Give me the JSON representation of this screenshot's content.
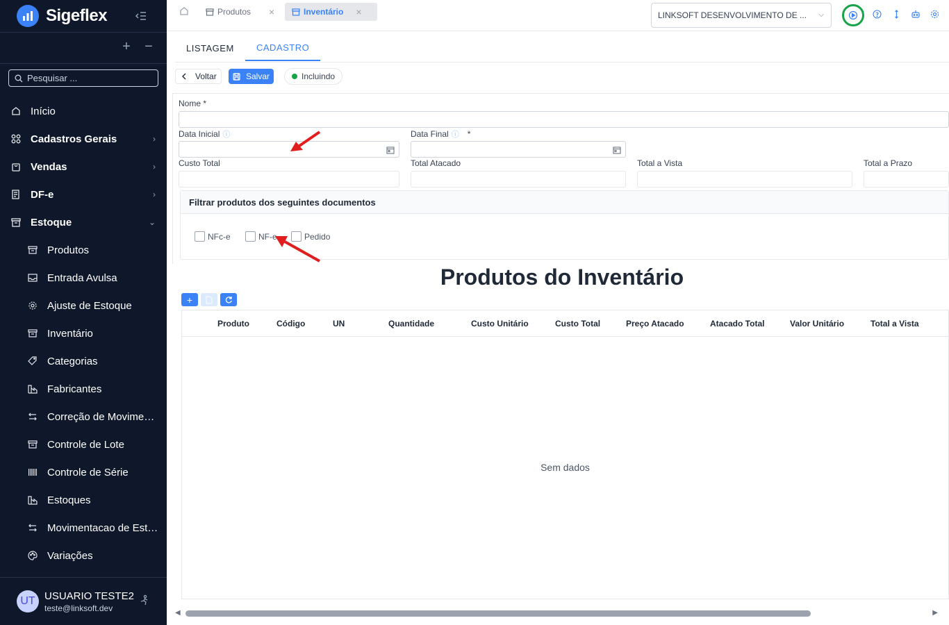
{
  "app": {
    "name": "Sigeflex"
  },
  "sidebar": {
    "search_placeholder": "Pesquisar ...",
    "items": [
      {
        "label": "Início",
        "icon": "home-icon"
      },
      {
        "label": "Cadastros Gerais",
        "icon": "grid-icon"
      },
      {
        "label": "Vendas",
        "icon": "shopping-bag-icon"
      },
      {
        "label": "DF-e",
        "icon": "document-icon"
      },
      {
        "label": "Estoque",
        "icon": "archive-icon"
      }
    ],
    "subitems": [
      {
        "label": "Produtos",
        "icon": "box-icon"
      },
      {
        "label": "Entrada Avulsa",
        "icon": "inbox-icon"
      },
      {
        "label": "Ajuste de Estoque",
        "icon": "settings-icon"
      },
      {
        "label": "Inventário",
        "icon": "box-icon"
      },
      {
        "label": "Categorias",
        "icon": "tag-icon"
      },
      {
        "label": "Fabricantes",
        "icon": "factory-icon"
      },
      {
        "label": "Correção de Movimento",
        "icon": "swap-icon"
      },
      {
        "label": "Controle de Lote",
        "icon": "box-icon"
      },
      {
        "label": "Controle de Série",
        "icon": "barcode-icon"
      },
      {
        "label": "Estoques",
        "icon": "factory-icon"
      },
      {
        "label": "Movimentacao de Estoque",
        "icon": "swap-icon"
      },
      {
        "label": "Variações",
        "icon": "palette-icon"
      }
    ],
    "user": {
      "initials": "UT",
      "name": "USUARIO TESTE2",
      "email": "teste@linksoft.dev"
    }
  },
  "topbar": {
    "tabs": [
      {
        "label": "Produtos",
        "active": false
      },
      {
        "label": "Inventário",
        "active": true
      }
    ],
    "close_glyph": "×",
    "company": "LINKSOFT DESENVOLVIMENTO DE ..."
  },
  "inner_tabs": [
    {
      "label": "LISTAGEM",
      "active": false
    },
    {
      "label": "CADASTRO",
      "active": true
    }
  ],
  "actions": {
    "back": "Voltar",
    "save": "Salvar",
    "status": "Incluindo"
  },
  "form": {
    "nome_label": "Nome *",
    "data_inicial_label": "Data Inicial",
    "data_final_label": "Data Final",
    "required_mark": "*",
    "custo_total_label": "Custo Total",
    "total_atacado_label": "Total Atacado",
    "total_vista_label": "Total a Vista",
    "total_prazo_label": "Total a Prazo"
  },
  "filter": {
    "title": "Filtrar produtos dos seguintes documentos",
    "options": [
      {
        "label": "NFc-e",
        "checked": false
      },
      {
        "label": "NF-e",
        "checked": false
      },
      {
        "label": "Pedido",
        "checked": false
      }
    ]
  },
  "products": {
    "title": "Produtos do Inventário",
    "columns": [
      "Produto",
      "Código",
      "UN",
      "Quantidade",
      "Custo Unitário",
      "Custo Total",
      "Preço Atacado",
      "Atacado Total",
      "Valor Unitário",
      "Total a Vista"
    ],
    "empty_text": "Sem dados"
  },
  "colors": {
    "accent": "#3b82f6",
    "sidebar_bg": "#0f172a",
    "status_green": "#16a34a",
    "annotation_red": "#e11d1d"
  }
}
